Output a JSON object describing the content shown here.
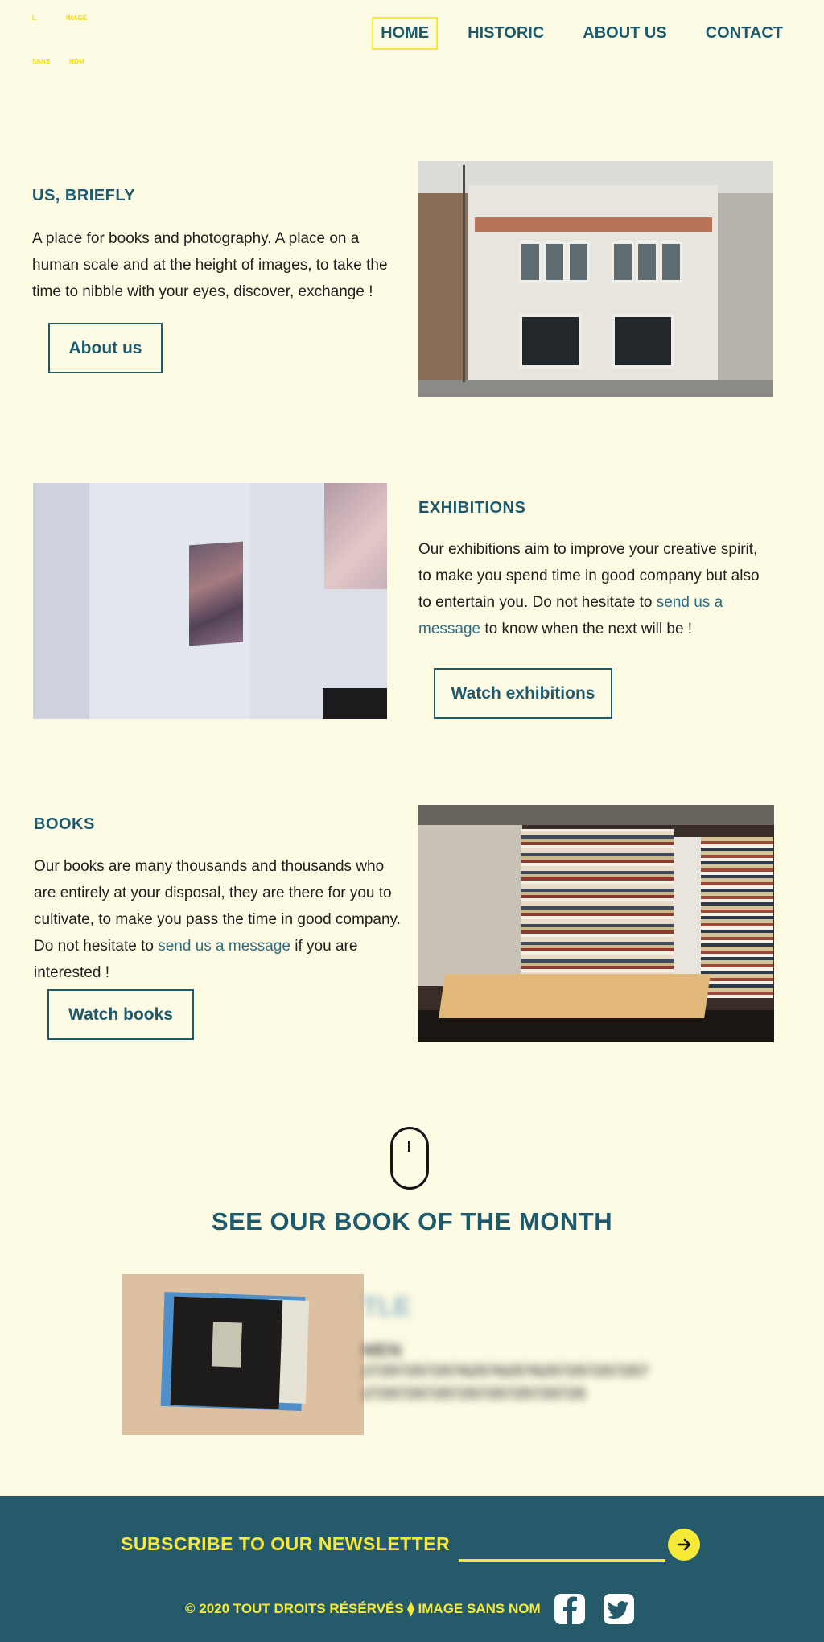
{
  "logo": {
    "line1_left": "L",
    "line1_right": "IMAGE",
    "line2_left": "SANS",
    "line2_right": "NOM",
    "color": "#f2dd00"
  },
  "nav": {
    "items": [
      {
        "label": "HOME",
        "active": true
      },
      {
        "label": "HISTORIC",
        "active": false
      },
      {
        "label": "ABOUT US",
        "active": false
      },
      {
        "label": "CONTACT",
        "active": false
      }
    ]
  },
  "sections": {
    "about": {
      "title": "US, BRIEFLY",
      "text": "A place for books and photography. A place on a human scale and at the height of images, to take the time to nibble with your eyes, discover, exchange !",
      "button": "About us"
    },
    "exhibitions": {
      "title": "EXHIBITIONS",
      "text_before": "Our exhibitions aim to improve your creative spirit, to make you spend time in good company but also to entertain you. Do not hesitate to ",
      "link": "send us a message",
      "text_after": " to know when the next will be !",
      "button": "Watch exhibitions"
    },
    "books": {
      "title": "BOOKS",
      "text_before": "Our books are many thousands and thousands who are entirely at your disposal, they are there for you to cultivate, to make you pass the time in good company. Do not hesitate to ",
      "link": "send us a message",
      "text_after": " if you are interested !",
      "button": "Watch books"
    }
  },
  "book_of_month": {
    "title": "SEE OUR BOOK OF THE MONTH",
    "blurred_title": "TLE",
    "blurred_subtitle": "MEN",
    "blurred_line1": "27257257257625762576257257257257",
    "blurred_line2": "2725725725725725725725725"
  },
  "footer": {
    "newsletter_label": "SUBSCRIBE TO OUR NEWSLETTER",
    "newsletter_placeholder": "",
    "copyright": "© 2020 TOUT DROITS RÉSÉRVÉS ⧫ IMAGE SANS NOM",
    "social": [
      "facebook-icon",
      "twitter-icon"
    ]
  },
  "colors": {
    "background": "#fefbe4",
    "primary": "#1d5a6e",
    "accent": "#f7e93a",
    "footer": "#255a6b",
    "link": "#2f6d80"
  }
}
